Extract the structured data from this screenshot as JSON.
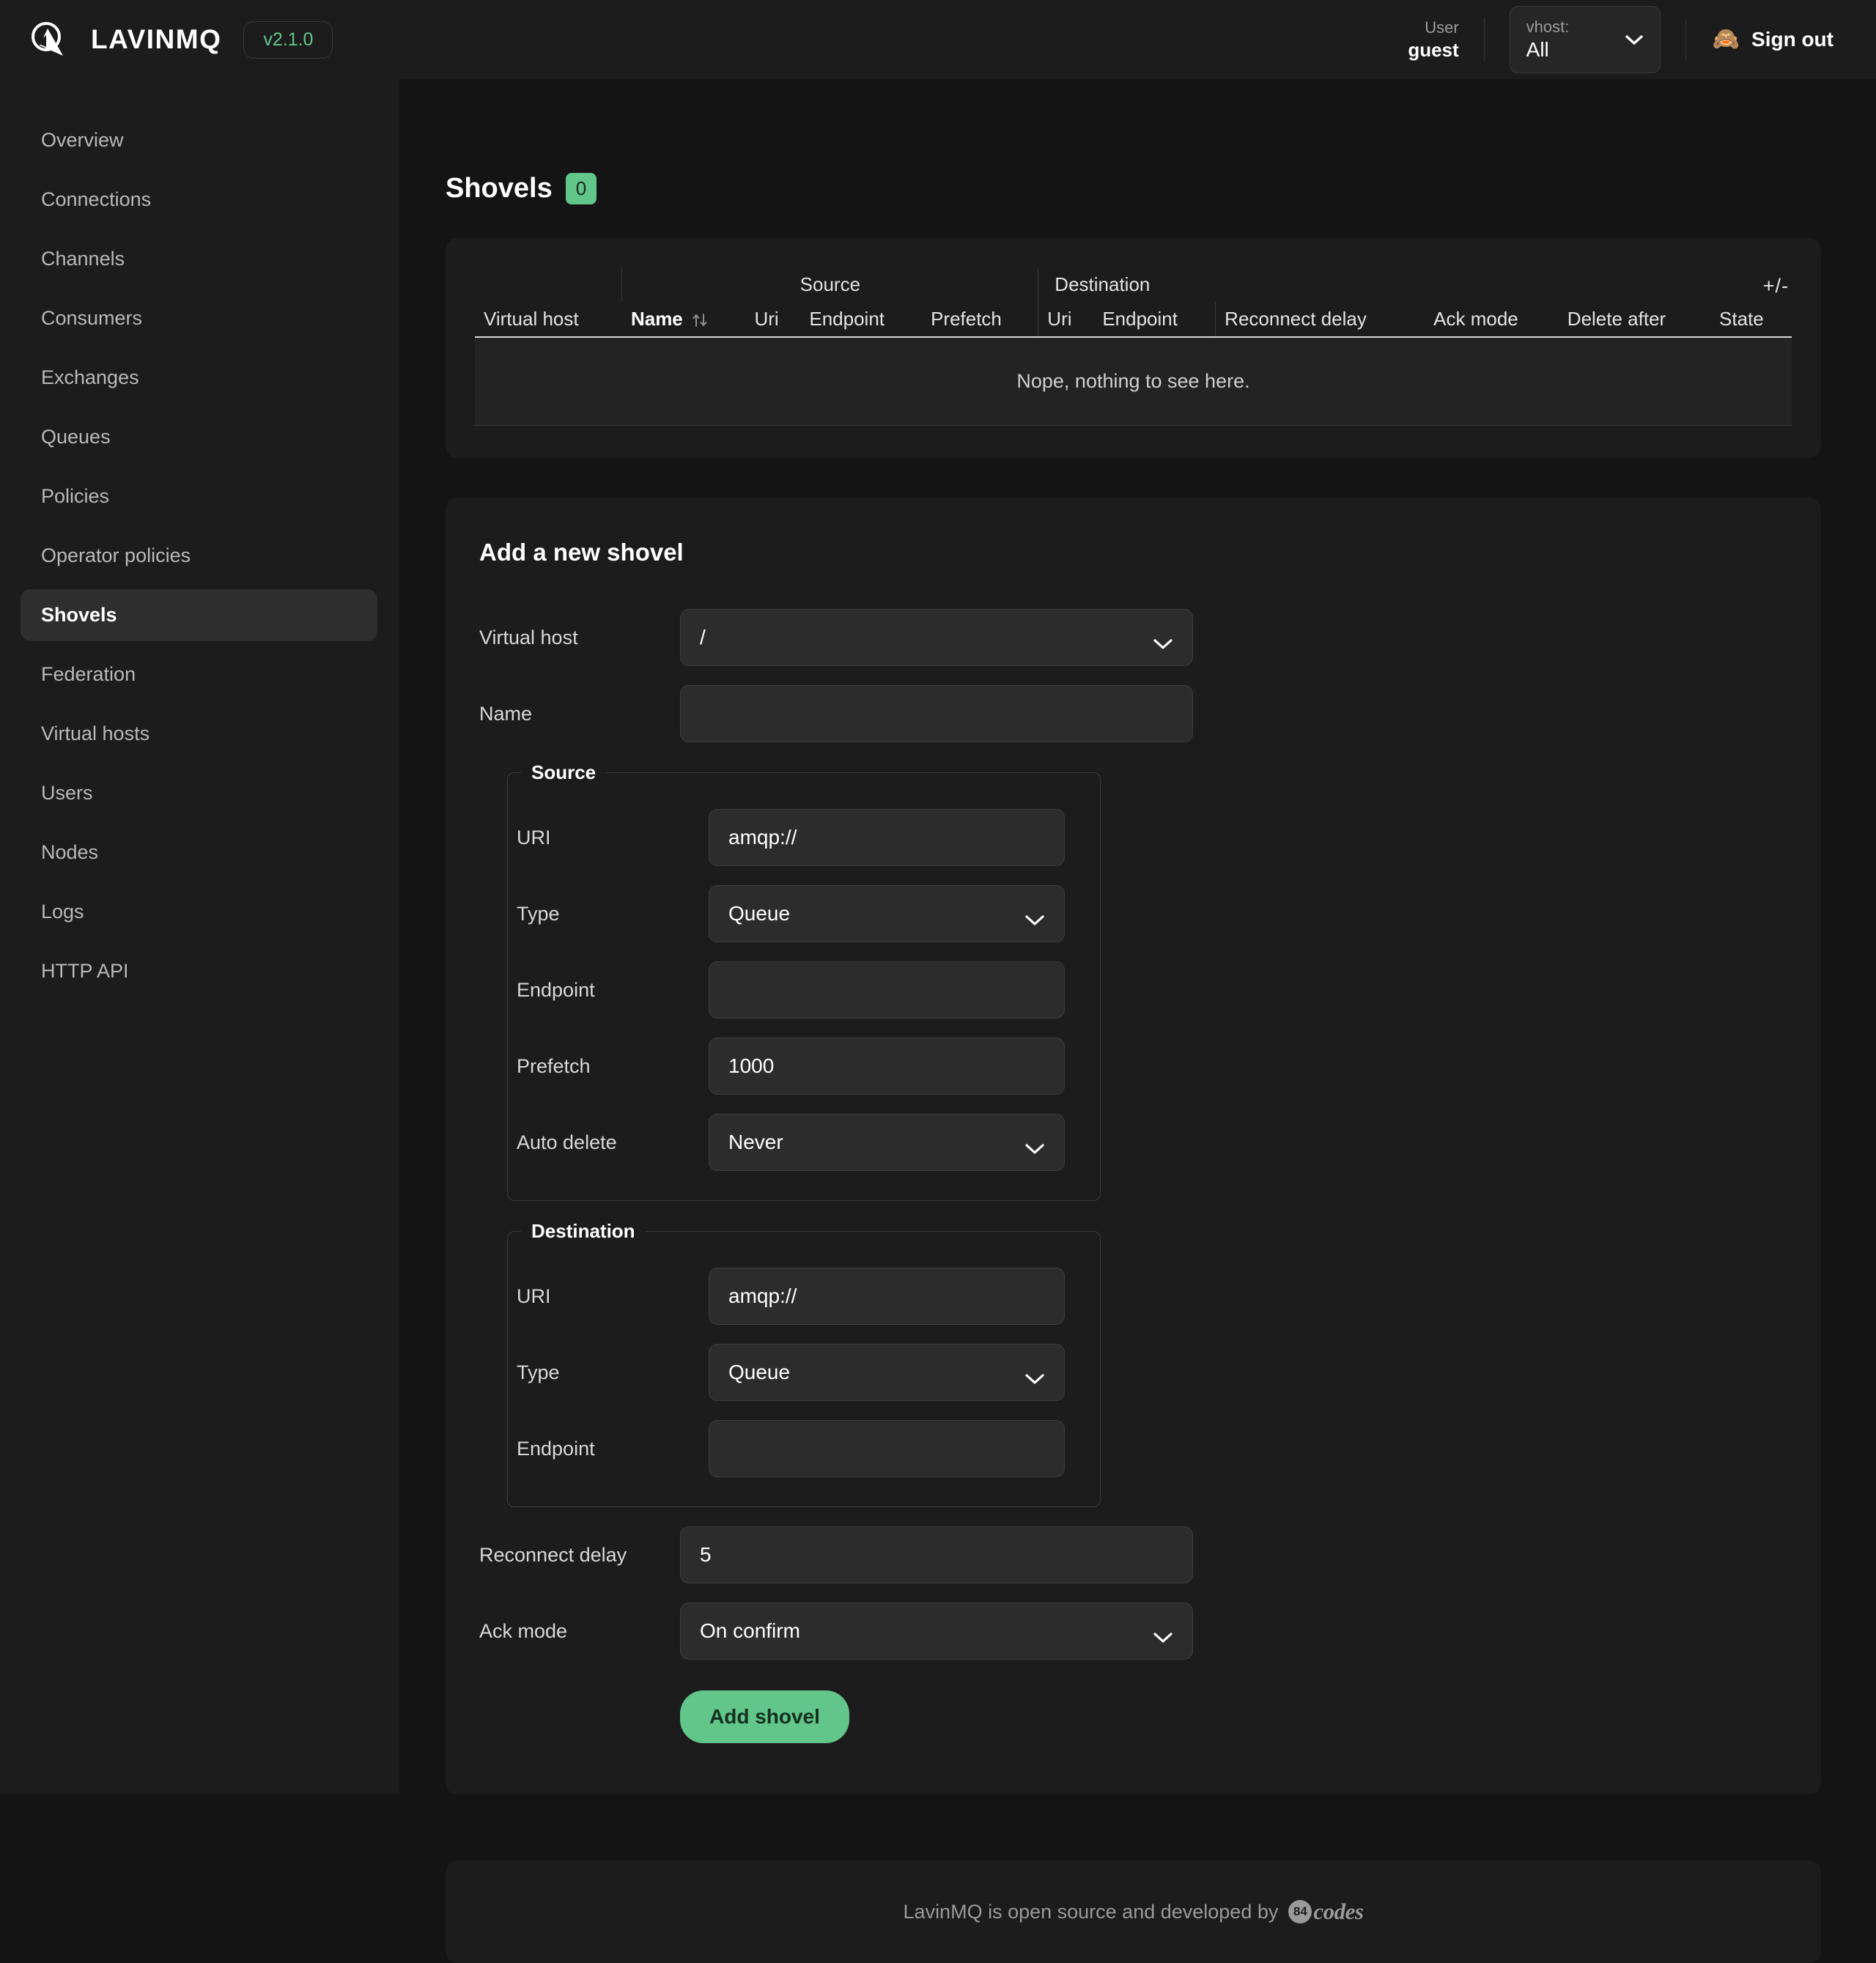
{
  "header": {
    "brand_name": "LAVINMQ",
    "version": "v2.1.0",
    "logo_icon": "lavinmq-logo-icon",
    "user_label": "User",
    "user_name": "guest",
    "vhost_label": "vhost:",
    "vhost_value": "All",
    "vhost_chevron_icon": "chevron-down-icon",
    "signout_emoji": "🙈",
    "signout_label": "Sign out"
  },
  "sidebar": {
    "items": [
      {
        "label": "Overview",
        "active": false
      },
      {
        "label": "Connections",
        "active": false
      },
      {
        "label": "Channels",
        "active": false
      },
      {
        "label": "Consumers",
        "active": false
      },
      {
        "label": "Exchanges",
        "active": false
      },
      {
        "label": "Queues",
        "active": false
      },
      {
        "label": "Policies",
        "active": false
      },
      {
        "label": "Operator policies",
        "active": false
      },
      {
        "label": "Shovels",
        "active": true
      },
      {
        "label": "Federation",
        "active": false
      },
      {
        "label": "Virtual hosts",
        "active": false
      },
      {
        "label": "Users",
        "active": false
      },
      {
        "label": "Nodes",
        "active": false
      },
      {
        "label": "Logs",
        "active": false
      },
      {
        "label": "HTTP API",
        "active": false
      }
    ]
  },
  "page": {
    "title": "Shovels",
    "count": "0"
  },
  "table": {
    "toggle_columns_label": "+/-",
    "group_headers": {
      "source": "Source",
      "destination": "Destination"
    },
    "columns": [
      "Virtual host",
      "Name",
      "Uri",
      "Endpoint",
      "Prefetch",
      "Uri",
      "Endpoint",
      "Reconnect delay",
      "Ack mode",
      "Delete after",
      "State"
    ],
    "sorted_column": "Name",
    "sort_icon": "sort-updown-icon",
    "empty_message": "Nope, nothing to see here."
  },
  "form": {
    "title": "Add a new shovel",
    "virtual_host": {
      "label": "Virtual host",
      "value": "/",
      "type": "select"
    },
    "name": {
      "label": "Name",
      "value": "",
      "type": "text"
    },
    "source": {
      "legend": "Source",
      "uri": {
        "label": "URI",
        "value": "amqp://",
        "type": "text"
      },
      "type": {
        "label": "Type",
        "value": "Queue",
        "type": "select"
      },
      "endpoint": {
        "label": "Endpoint",
        "value": "",
        "type": "text"
      },
      "prefetch": {
        "label": "Prefetch",
        "value": "1000",
        "type": "text"
      },
      "auto_delete": {
        "label": "Auto delete",
        "value": "Never",
        "type": "select"
      }
    },
    "destination": {
      "legend": "Destination",
      "uri": {
        "label": "URI",
        "value": "amqp://",
        "type": "text"
      },
      "type": {
        "label": "Type",
        "value": "Queue",
        "type": "select"
      },
      "endpoint": {
        "label": "Endpoint",
        "value": "",
        "type": "text"
      }
    },
    "reconnect_delay": {
      "label": "Reconnect delay",
      "value": "5",
      "type": "text"
    },
    "ack_mode": {
      "label": "Ack mode",
      "value": "On confirm",
      "type": "select"
    },
    "submit_label": "Add shovel"
  },
  "footer": {
    "text": "LavinMQ is open source and developed by",
    "logo_badge": "84",
    "logo_word": "codes"
  }
}
